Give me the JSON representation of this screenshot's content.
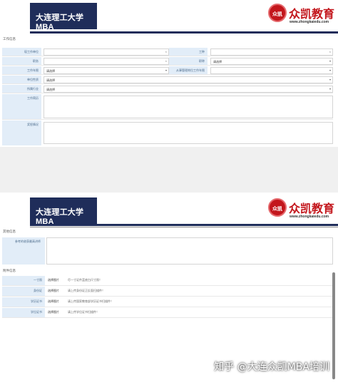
{
  "header": {
    "logo_text": "大连理工大学MBA",
    "brand_name": "众凯教育",
    "brand_url": "www.zhongkaiedu.com",
    "seal_text": "众凯"
  },
  "work": {
    "section_title": "工作信息",
    "company_label": "现工作单位",
    "company_value": "",
    "title_label": "工种",
    "title_value": "",
    "position_label": "职务",
    "position_value": "",
    "duty_label": "职称",
    "duty_value": "请选择",
    "years_label": "工作年限",
    "years_value": "请选择",
    "mgmt_years_label": "从事管理岗位工作年限",
    "mgmt_years_value": "",
    "nature_label": "单位性质",
    "nature_value": "请选择",
    "industry_label": "所属行业",
    "industry_value": "请选择",
    "resume_label": "工作简历",
    "resume_value": "",
    "award_label": "奖惩情况",
    "award_value": ""
  },
  "other": {
    "section_title": "其他信息",
    "note_label": "参考的收获最高讲师"
  },
  "attach": {
    "section_title": "附件信息",
    "items": [
      {
        "label": "一寸照",
        "choose": "选择图片",
        "hint": "尽一寸证件蓝底白尺寸照！"
      },
      {
        "label": "身份证",
        "choose": "选择图片",
        "hint": "请上传身份证正反面扫描件！"
      },
      {
        "label": "学历证书",
        "choose": "选择图片",
        "hint": "请上传国家教育部学历证书扫描件！"
      },
      {
        "label": "学位证书",
        "choose": "选择图片",
        "hint": "请上传学位证书扫描件！"
      }
    ]
  },
  "watermark": "知乎 @大连众凯MBA培训",
  "colors": {
    "navy": "#1f2d5a",
    "brand_red": "#c3161c",
    "label_bg": "#e2edf8"
  }
}
